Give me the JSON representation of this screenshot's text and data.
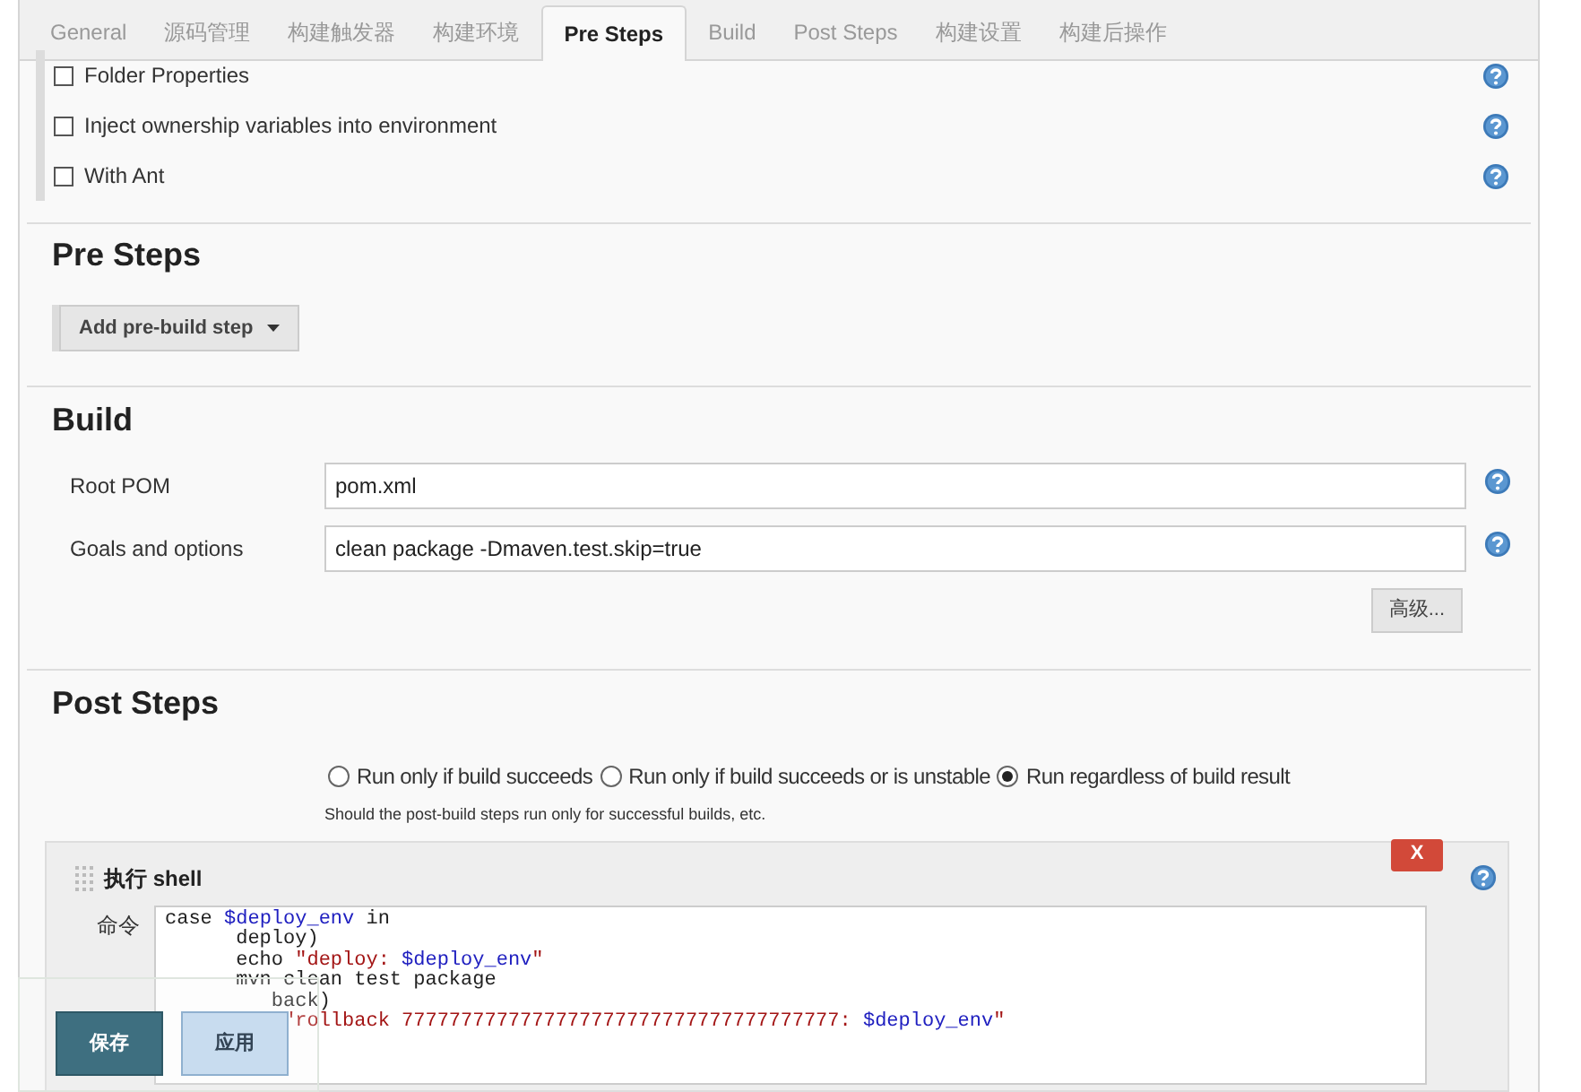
{
  "tabs": [
    {
      "label": "General",
      "selected": false
    },
    {
      "label": "源码管理",
      "selected": false
    },
    {
      "label": "构建触发器",
      "selected": false
    },
    {
      "label": "构建环境",
      "selected": false
    },
    {
      "label": "Pre Steps",
      "selected": true
    },
    {
      "label": "Build",
      "selected": false
    },
    {
      "label": "Post Steps",
      "selected": false
    },
    {
      "label": "构建设置",
      "selected": false
    },
    {
      "label": "构建后操作",
      "selected": false
    }
  ],
  "env_options": [
    {
      "label": "Folder Properties",
      "checked": false
    },
    {
      "label": "Inject ownership variables into environment",
      "checked": false
    },
    {
      "label": "With Ant",
      "checked": false
    }
  ],
  "pre_steps": {
    "title": "Pre Steps",
    "add_button": "Add pre-build step"
  },
  "build": {
    "title": "Build",
    "fields": [
      {
        "label": "Root POM",
        "value": "pom.xml"
      },
      {
        "label": "Goals and options",
        "value": "clean package -Dmaven.test.skip=true"
      }
    ],
    "advanced_button": "高级..."
  },
  "post_steps": {
    "title": "Post Steps",
    "options": [
      {
        "label": "Run only if build succeeds",
        "selected": false
      },
      {
        "label": "Run only if build succeeds or is unstable",
        "selected": false
      },
      {
        "label": "Run regardless of build result",
        "selected": true
      }
    ],
    "hint": "Should the post-build steps run only for successful builds, etc."
  },
  "shell_step": {
    "title": "执行 shell",
    "delete_button": "X",
    "command_label": "命令",
    "code_lines": [
      [
        {
          "kind": "plain",
          "text": "case "
        },
        {
          "kind": "var",
          "text": "$deploy_env"
        },
        {
          "kind": "plain",
          "text": " in"
        }
      ],
      [
        {
          "kind": "plain",
          "text": "      deploy)"
        }
      ],
      [
        {
          "kind": "plain",
          "text": "      echo "
        },
        {
          "kind": "string",
          "text": "\"deploy: "
        },
        {
          "kind": "var",
          "text": "$deploy_env"
        },
        {
          "kind": "string",
          "text": "\""
        }
      ],
      [
        {
          "kind": "plain",
          "text": "      mvn clean test package"
        }
      ],
      [
        {
          "kind": "plain",
          "text": "         back)"
        }
      ],
      [
        {
          "kind": "string",
          "text": "          \"rollback 7777777777777777777777777777777777777: "
        },
        {
          "kind": "var",
          "text": "$deploy_env"
        },
        {
          "kind": "string",
          "text": "\""
        }
      ]
    ]
  },
  "save_bar": {
    "save_button": "保存",
    "apply_button": "应用"
  }
}
